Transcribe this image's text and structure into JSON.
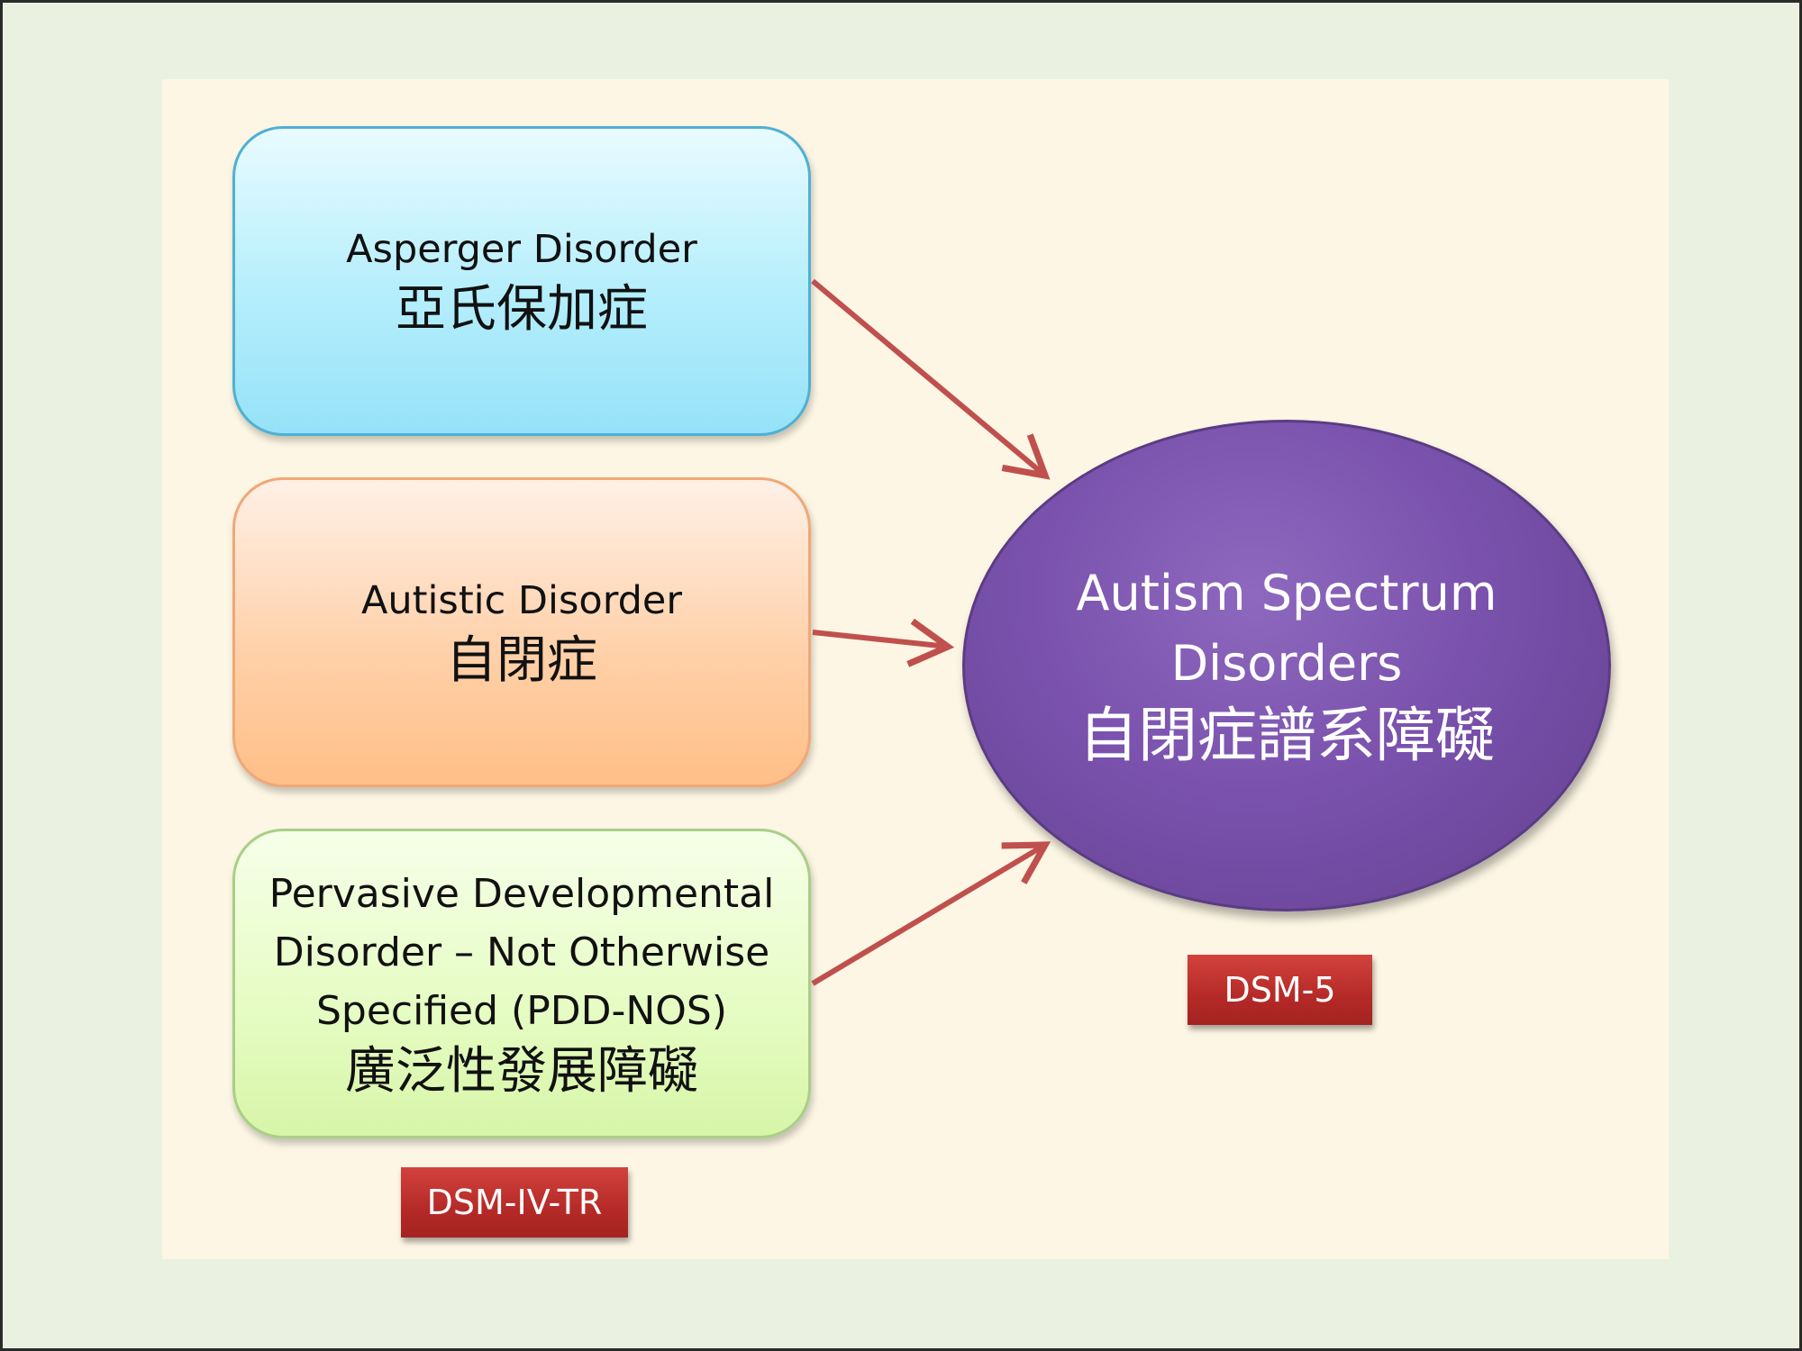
{
  "left_boxes": [
    {
      "en": "Asperger Disorder",
      "zh": "亞氏保加症"
    },
    {
      "en": "Autistic Disorder",
      "zh": "自閉症"
    },
    {
      "en_lines": [
        "Pervasive Developmental",
        "Disorder – Not Otherwise",
        "Specified (PDD-NOS)"
      ],
      "zh": "廣泛性發展障礙"
    }
  ],
  "target": {
    "en_lines": [
      "Autism Spectrum",
      "Disorders"
    ],
    "zh": "自閉症譜系障礙"
  },
  "tags": {
    "left": "DSM-IV-TR",
    "right": "DSM-5"
  },
  "colors": {
    "arrow": "#c0504d",
    "target_fill": "#7a52ad",
    "tag_fill": "#b52a27"
  }
}
